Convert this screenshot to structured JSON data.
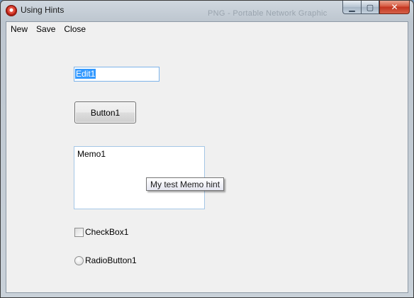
{
  "window": {
    "title": "Using Hints",
    "background_title_text": "PNG - Portable Network Graphic"
  },
  "caption": {
    "minimize_glyph": "▁",
    "maximize_glyph": "▢",
    "close_glyph": "✕"
  },
  "menu": {
    "items": [
      {
        "label": "New"
      },
      {
        "label": "Save"
      },
      {
        "label": "Close"
      }
    ]
  },
  "edit1": {
    "value": "Edit1",
    "selected": true
  },
  "button1": {
    "label": "Button1"
  },
  "memo1": {
    "value": "Memo1"
  },
  "hint": {
    "text": "My test Memo hint"
  },
  "checkbox1": {
    "label": "CheckBox1",
    "checked": false
  },
  "radiobutton1": {
    "label": "RadioButton1",
    "checked": false
  },
  "colors": {
    "selection": "#3399ff",
    "client_bg": "#f0f0f0",
    "close_button": "#c2341f"
  }
}
